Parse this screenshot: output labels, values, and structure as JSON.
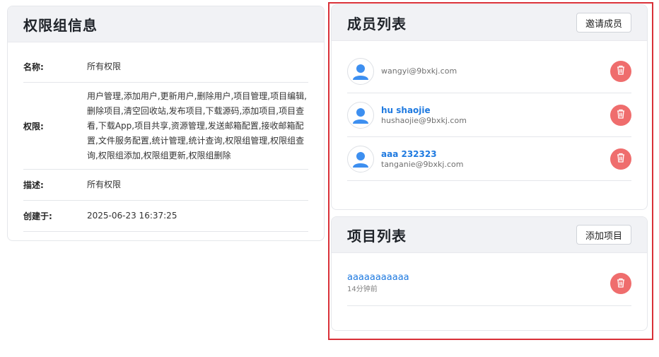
{
  "permission_group": {
    "title": "权限组信息",
    "rows": [
      {
        "label": "名称:",
        "value": "所有权限"
      },
      {
        "label": "权限:",
        "value": "用户管理,添加用户,更新用户,删除用户,项目管理,项目编辑,删除项目,清空回收站,发布项目,下载源码,添加项目,项目查看,下载App,项目共享,资源管理,发送邮箱配置,接收邮箱配置,文件服务配置,统计管理,统计查询,权限组管理,权限组查询,权限组添加,权限组更新,权限组删除"
      },
      {
        "label": "描述:",
        "value": "所有权限"
      },
      {
        "label": "创建于:",
        "value": "2025-06-23 16:37:25"
      }
    ]
  },
  "members": {
    "title": "成员列表",
    "invite_label": "邀请成员",
    "items": [
      {
        "name": "",
        "email": "wangyi@9bxkj.com"
      },
      {
        "name": "hu shaojie",
        "email": "hushaojie@9bxkj.com"
      },
      {
        "name": "aaa 232323",
        "email": "tanganie@9bxkj.com"
      }
    ]
  },
  "projects": {
    "title": "项目列表",
    "add_label": "添加项目",
    "items": [
      {
        "name": "aaaaaaaaaaa",
        "time": "14分钟前"
      }
    ]
  },
  "colors": {
    "accent": "#1f7ae0",
    "danger": "#ef6d6d",
    "header_bg": "#f1f2f5",
    "selection": "#d93038"
  },
  "icons": {
    "avatar": "user-avatar-icon",
    "delete": "trash-icon"
  }
}
